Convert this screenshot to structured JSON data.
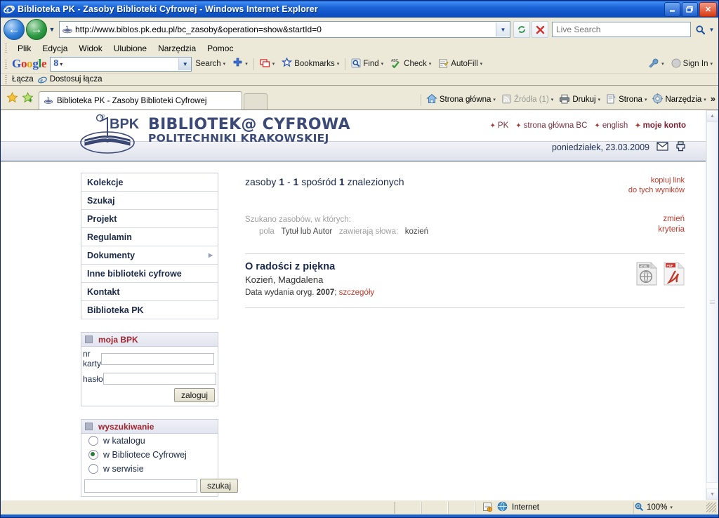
{
  "window": {
    "title": "Biblioteka PK - Zasoby Biblioteki Cyfrowej - Windows Internet Explorer",
    "minimize_label": "_",
    "maximize_label": "❐",
    "close_label": "✕"
  },
  "address_bar": {
    "url": "http://www.biblos.pk.edu.pl/bc_zasoby&operation=show&startId=0",
    "refresh_title": "Odśwież",
    "stop_title": "Zatrzymaj",
    "search_placeholder": "Live Search",
    "search_value": ""
  },
  "menu": {
    "items": [
      {
        "label": "Plik",
        "accel": "P"
      },
      {
        "label": "Edycja",
        "accel": "E"
      },
      {
        "label": "Widok",
        "accel": "W"
      },
      {
        "label": "Ulubione",
        "accel": "U"
      },
      {
        "label": "Narzędzia",
        "accel": "N"
      },
      {
        "label": "Pomoc",
        "accel": "c"
      }
    ]
  },
  "google_toolbar": {
    "logo": [
      "G",
      "o",
      "o",
      "g",
      "l",
      "e"
    ],
    "box_prefix": "8",
    "query": "",
    "search_label": "Search",
    "bookmarks_label": "Bookmarks",
    "find_label": "Find",
    "check_label": "Check",
    "autofill_label": "AutoFill",
    "signin_label": "Sign In"
  },
  "links_bar": {
    "label": "Łącza",
    "item": "Dostosuj łącza"
  },
  "tab_bar": {
    "tab_title": "Biblioteka PK - Zasoby Biblioteki Cyfrowej",
    "commands": [
      {
        "label": "Strona główna",
        "dim": false,
        "caret": true
      },
      {
        "label": "Źródła (1)",
        "dim": true,
        "caret": true
      },
      {
        "label": "Drukuj",
        "dim": false,
        "caret": true
      },
      {
        "label": "Strona",
        "dim": false,
        "caret": true
      },
      {
        "label": "Narzędzia",
        "dim": false,
        "caret": true
      }
    ],
    "overflow": "»"
  },
  "site": {
    "logo_text": "BPK",
    "brand_line1": "BIBLIOTEK@ CYFROWA",
    "brand_line2": "POLITECHNIKI KRAKOWSKIEJ",
    "top_links": [
      {
        "label": "PK",
        "bold": false
      },
      {
        "label": "strona główna BC",
        "bold": false
      },
      {
        "label": "english",
        "bold": false
      },
      {
        "label": "moje konto",
        "bold": true
      }
    ],
    "date": "poniedziałek, 23.03.2009",
    "nav": [
      {
        "label": "Kolekcje",
        "submenu": false
      },
      {
        "label": "Szukaj",
        "submenu": false
      },
      {
        "label": "Projekt",
        "submenu": false
      },
      {
        "label": "Regulamin",
        "submenu": false
      },
      {
        "label": "Dokumenty",
        "submenu": true
      },
      {
        "label": "Inne biblioteki cyfrowe",
        "submenu": false
      },
      {
        "label": "Kontakt",
        "submenu": false
      },
      {
        "label": "Biblioteka PK",
        "submenu": false
      }
    ],
    "login_panel": {
      "title": "moja BPK",
      "card_label": "nr karty",
      "card_value": "",
      "password_label": "hasło",
      "password_value": "",
      "submit_label": "zaloguj"
    },
    "search_panel": {
      "title": "wyszukiwanie",
      "options": [
        {
          "label": "w katalogu",
          "selected": false
        },
        {
          "label": "w Bibliotece Cyfrowej",
          "selected": true
        },
        {
          "label": "w serwisie",
          "selected": false
        }
      ],
      "query": "",
      "submit_label": "szukaj"
    },
    "results": {
      "prefix": "zasoby",
      "from": "1",
      "dash": "-",
      "to": "1",
      "middle": "spośród",
      "total": "1",
      "suffix": "znalezionych",
      "copy_link_line1": "kopiuj link",
      "copy_link_line2": "do tych wyników",
      "criteria_intro": "Szukano zasobów, w których:",
      "criteria_field_label": "pola",
      "criteria_field_value": "Tytuł lub Autor",
      "criteria_contains_label": "zawierają słowa:",
      "criteria_contains_value": "kozień",
      "change_line1": "zmień",
      "change_line2": "kryteria",
      "items": [
        {
          "title": "O radości z piękna",
          "author": "Kozień, Magdalena",
          "meta_label": "Data wydania oryg.",
          "meta_value": "2007",
          "details_link": "szczegóły",
          "formats": [
            "html-icon",
            "pdf-icon"
          ]
        }
      ]
    }
  },
  "status_bar": {
    "zone": "Internet",
    "zoom": "100%"
  },
  "colors": {
    "accent_red": "#c0392b",
    "brand_blue": "#3b4a77",
    "title_blue": "#1b63d6"
  }
}
